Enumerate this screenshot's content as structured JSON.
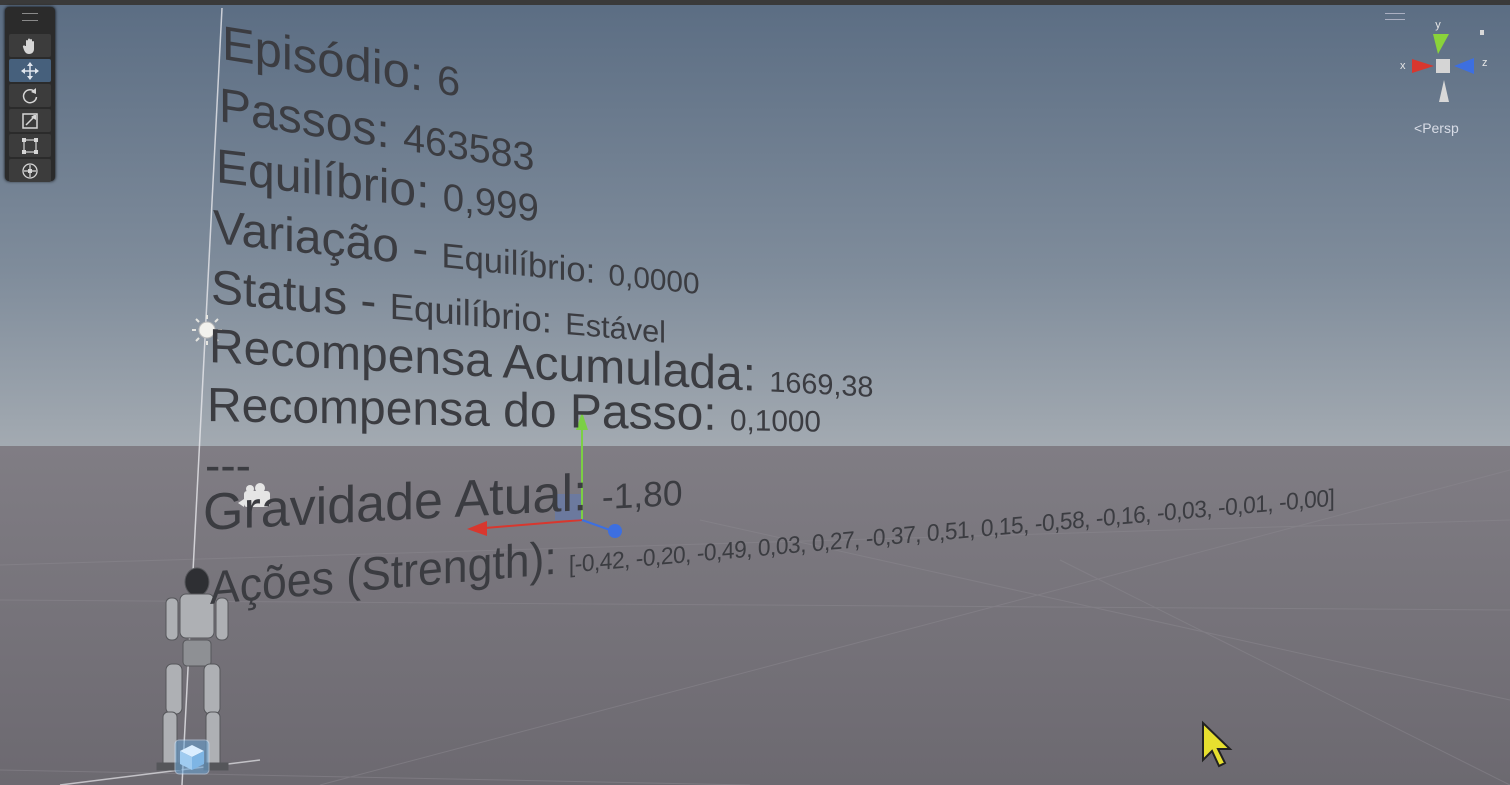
{
  "hud": {
    "episode": {
      "label": "Episódio:",
      "value": "6"
    },
    "steps": {
      "label": "Passos:",
      "value": "463583"
    },
    "balance": {
      "label": "Equilíbrio:",
      "value": "0,999"
    },
    "balance_variation": {
      "label": "Variação - Equilíbrio:",
      "value": "0,0000"
    },
    "balance_status": {
      "label": "Status - Equilíbrio:",
      "value": "Estável"
    },
    "cumulative_reward": {
      "label": "Recompensa Acumulada:",
      "value": "1669,38"
    },
    "step_reward": {
      "label": "Recompensa do Passo:",
      "value": "0,1000"
    },
    "separator": "---",
    "gravity": {
      "label": "Gravidade Atual:",
      "value": "-1,80"
    },
    "actions": {
      "label": "Ações (Strength):",
      "value": "[-0,42, -0,20, -0,49, 0,03, 0,27, -0,37, 0,51, 0,15, -0,58, -0,16, -0,03, -0,01, -0,00]"
    }
  },
  "scene_gizmo": {
    "axes": {
      "x": "x",
      "y": "y",
      "z": "z"
    },
    "projection_label": "Persp",
    "colors": {
      "x": "#d8372e",
      "y": "#8ad33a",
      "z": "#3d6fe0"
    }
  },
  "toolbar": {
    "tools": [
      "hand-tool",
      "move-tool",
      "rotate-tool",
      "scale-tool",
      "rect-tool",
      "transform-tool"
    ],
    "active_tool": "move-tool"
  },
  "colors": {
    "sky_top": "#5f7187",
    "sky_horizon": "#9ba4ae",
    "ground": "#76737a",
    "text": "#3b3c41"
  }
}
